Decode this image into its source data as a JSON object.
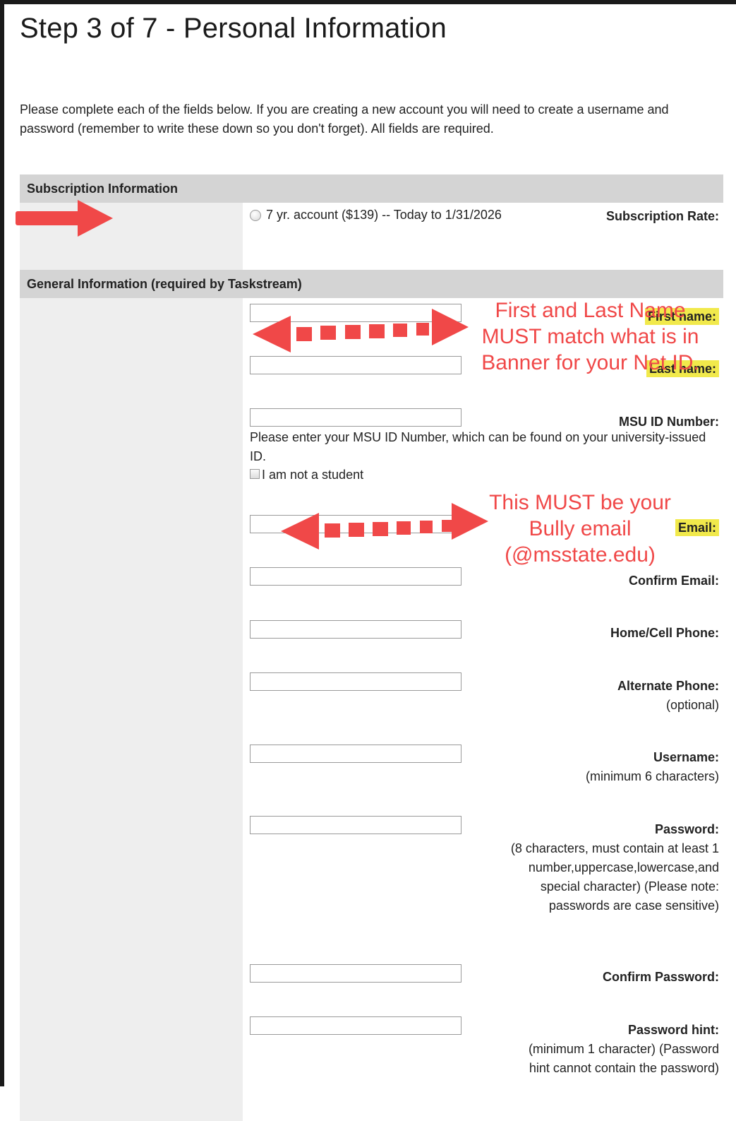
{
  "page": {
    "title": "Step 3 of 7 - Personal Information",
    "intro": "Please complete each of the fields below. If you are creating a new account you will need to create a username and password (remember to write these down so you don't forget). All fields are required."
  },
  "subscription": {
    "heading": "Subscription Information",
    "rate_label": "Subscription Rate:",
    "rate_option": "7 yr. account ($139) -- Today to 1/31/2026"
  },
  "general": {
    "heading": "General Information (required by Taskstream)",
    "first_name_label": "First name:",
    "last_name_label": "Last name:",
    "msu_id_label": "MSU ID Number:",
    "msu_id_help": "Please enter your MSU ID Number, which can be found on your university-issued ID.",
    "not_student_label": "I am not a student",
    "email_label": "Email:",
    "confirm_email_label": "Confirm Email:",
    "home_phone_label": "Home/Cell Phone:",
    "alt_phone_label": "Alternate Phone:",
    "alt_phone_note": "(optional)",
    "username_label": "Username:",
    "username_note": "(minimum 6 characters)",
    "password_label": "Password:",
    "password_note": "(8 characters, must contain at least 1 number,uppercase,lowercase,and special character) (Please note: passwords are case sensitive)",
    "confirm_password_label": "Confirm Password:",
    "password_hint_label": "Password hint:",
    "password_hint_note": "(minimum 1 character) (Password hint cannot contain the password)"
  },
  "annotations": {
    "name_note": "First and Last Name MUST match what is in Banner for your Net ID.",
    "email_note": "This MUST be your Bully email (@msstate.edu)",
    "arrow_color": "#f04848",
    "highlight_color": "#f1e94b"
  }
}
